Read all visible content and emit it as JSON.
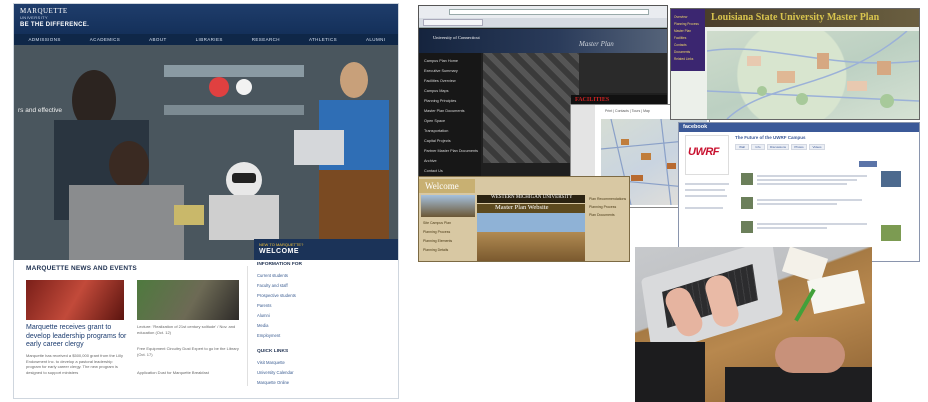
{
  "marquette": {
    "logo_name": "MARQUETTE",
    "logo_sub": "UNIVERSITY",
    "tagline": "BE THE DIFFERENCE.",
    "nav": [
      "ADMISSIONS",
      "ACADEMICS",
      "ABOUT",
      "LIBRARIES",
      "RESEARCH",
      "ATHLETICS",
      "ALUMNI"
    ],
    "hero_text": "rs and effective",
    "welcome_small": "NEW TO MARQUETTE?",
    "welcome": "WELCOME",
    "news_title": "MARQUETTE NEWS AND EVENTS",
    "headline": "Marquette receives grant to develop leadership programs for early career clergy",
    "body1": "Marquette has received a $500,000 grant from the Lilly Endowment Inc. to develop a pastoral leadership program for early career clergy. The new program is designed to support ministers",
    "body2": "Lecture: 'Realization of 21st century solitude' / Nov. and education (Oct. 12)",
    "body3": "Free Equipment Circuitry Dust Expert to go be the Library (Oct. 17)",
    "body4": "Application Dust for Marquette Breakfast",
    "info_title": "INFORMATION FOR",
    "info_links": [
      "Current students",
      "Faculty and staff",
      "Prospective students",
      "Parents",
      "Alumni",
      "Media",
      "Employment"
    ],
    "quick_title": "QUICK LINKS",
    "quick_links": [
      "Visit Marquette",
      "University Calendar",
      "Marquette Online"
    ]
  },
  "uconn": {
    "logo": "University of Connecticut",
    "master": "Master Plan",
    "side_items": [
      "Campus Plan Home",
      "Executive Summary",
      "Facilities Overview",
      "Campus Maps",
      "Planning Principles",
      "Master Plan Documents",
      "Open Space",
      "Transportation",
      "Capital Projects",
      "Partner Master Plan Documents",
      "Archive",
      "Contact Us"
    ],
    "facilities": "FACILITIES"
  },
  "map_doc": {
    "links": "Print | Contacts | Tours | Map"
  },
  "eastern": {
    "title": "Louisiana State University Master Plan",
    "links": [
      "Overview",
      "Planning Process",
      "Master Plan",
      "Facilities",
      "Contacts",
      "Documents",
      "Related Links"
    ]
  },
  "facebook": {
    "logo": "facebook",
    "title": "The Future of the UWRF Campus",
    "uwrf": "UWRF",
    "tabs": [
      "Wall",
      "Info",
      "Discussions",
      "Photos",
      "Videos"
    ]
  },
  "wmu": {
    "welcome": "Welcome",
    "university": "WESTERN MICHIGAN UNIVERSITY",
    "master_plan": "Master Plan Website",
    "left_links": [
      "Site Campus Plan",
      "Planning Process",
      "Planning Elements",
      "Planning Details"
    ],
    "right_links": [
      "Plan Recommendations",
      "Planning Process",
      "Plan Documents"
    ]
  },
  "colors": {
    "marquette_navy": "#14305a",
    "uconn_dark": "#15243e",
    "eastern_purple": "#3b2670",
    "eastern_gold": "#d8c44e",
    "facebook_blue": "#3b5998",
    "uwrf_red": "#c8102e",
    "wmu_tan": "#d8c8a3"
  }
}
